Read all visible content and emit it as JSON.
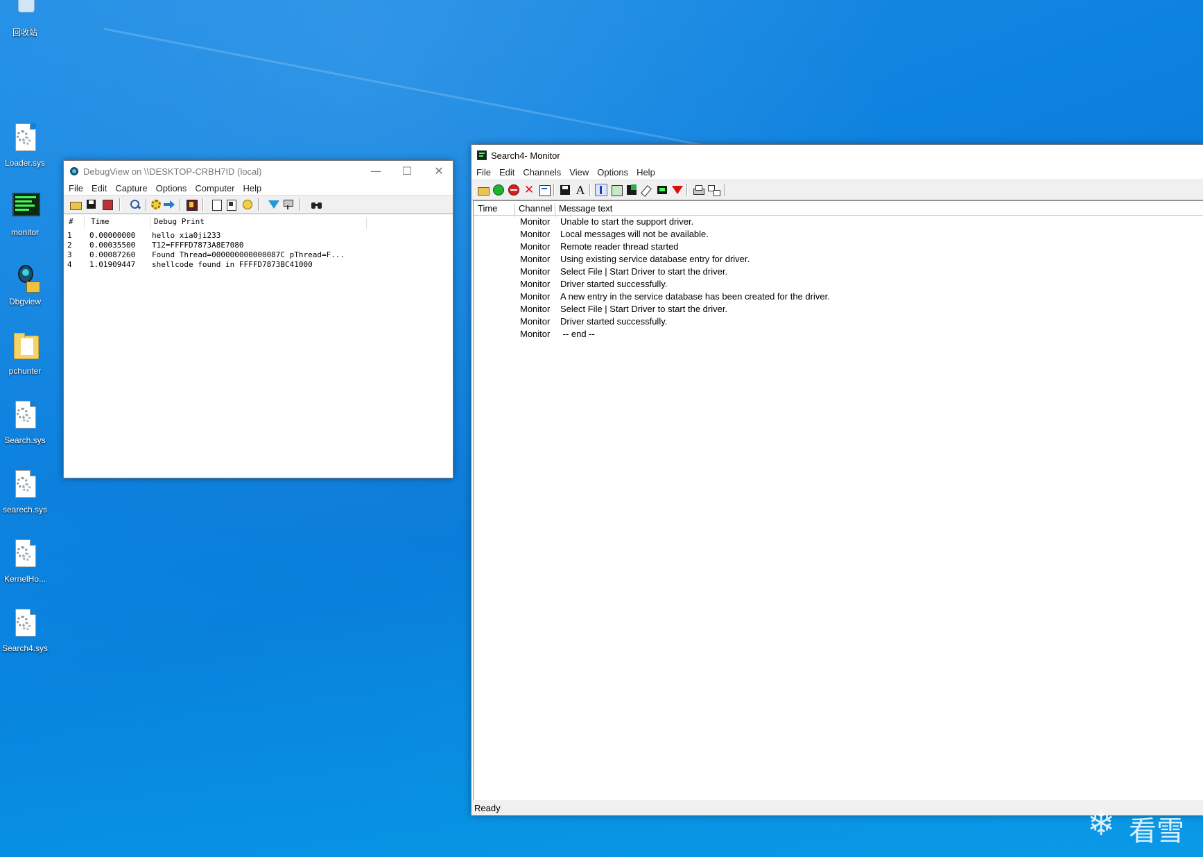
{
  "desktop": {
    "icons": [
      {
        "label": "回收站",
        "icon": "recycle-bin-icon"
      },
      {
        "label": "Loader.sys",
        "icon": "system-file-icon"
      },
      {
        "label": "monitor",
        "icon": "monitor-app-icon"
      },
      {
        "label": "Dbgview",
        "icon": "bug-icon"
      },
      {
        "label": "pchunter",
        "icon": "folder-icon"
      },
      {
        "label": "Search.sys",
        "icon": "system-file-icon"
      },
      {
        "label": "searech.sys",
        "icon": "system-file-icon"
      },
      {
        "label": "KernelHo...",
        "icon": "system-file-icon"
      },
      {
        "label": "Search4.sys",
        "icon": "system-file-icon"
      }
    ],
    "watermark_text": "看雪"
  },
  "debugview": {
    "title": "DebugView on \\\\DESKTOP-CRBH7ID (local)",
    "menu": [
      "File",
      "Edit",
      "Capture",
      "Options",
      "Computer",
      "Help"
    ],
    "columns": [
      "#",
      "Time",
      "Debug Print"
    ],
    "rows": [
      {
        "num": "1",
        "time": "0.00000000",
        "text": "hello xia0ji233"
      },
      {
        "num": "2",
        "time": "0.00035500",
        "text": "T12=FFFFD7873A8E7080"
      },
      {
        "num": "3",
        "time": "0.00087260",
        "text": "Found Thread=000000000000087C pThread=F..."
      },
      {
        "num": "4",
        "time": "1.01909447",
        "text": "shellcode found in FFFFD7873BC41000"
      }
    ],
    "caption_buttons": {
      "minimize": "—",
      "maximize": "☐",
      "close": "✕"
    }
  },
  "monitor": {
    "title": "Search4- Monitor",
    "menu": [
      "File",
      "Edit",
      "Channels",
      "View",
      "Options",
      "Help"
    ],
    "columns": [
      "Time",
      "Channel",
      "Message text"
    ],
    "rows": [
      {
        "time": "",
        "channel": "Monitor",
        "message": "Unable to start the support driver."
      },
      {
        "time": "",
        "channel": "Monitor",
        "message": "Local messages will not be available."
      },
      {
        "time": "",
        "channel": "Monitor",
        "message": "Remote reader thread started"
      },
      {
        "time": "",
        "channel": "Monitor",
        "message": "Using existing service database entry for driver."
      },
      {
        "time": "",
        "channel": "Monitor",
        "message": "Select File | Start Driver to start the driver."
      },
      {
        "time": "",
        "channel": "Monitor",
        "message": "Driver started successfully."
      },
      {
        "time": "",
        "channel": "Monitor",
        "message": "A new entry in the service database has been created for the driver."
      },
      {
        "time": "",
        "channel": "Monitor",
        "message": "Select File | Start Driver to start the driver."
      },
      {
        "time": "",
        "channel": "Monitor",
        "message": "Driver started successfully."
      },
      {
        "time": "",
        "channel": "Monitor",
        "message": " -- end --"
      }
    ],
    "status": "Ready"
  }
}
